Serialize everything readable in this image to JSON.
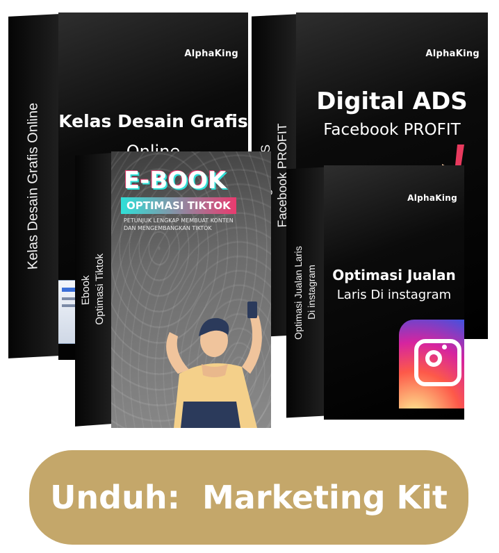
{
  "products": {
    "box1": {
      "spine": "Kelas Desain Grafis Online",
      "brand": "AlphaKing",
      "title_line1": "Kelas Desain Grafis",
      "title_line2": "Online"
    },
    "box2": {
      "spine_line1": "Digital ADS",
      "spine_line2": "Facebook PROFIT",
      "brand": "AlphaKing",
      "title": "Digital ADS",
      "subtitle": "Facebook PROFIT"
    },
    "box3": {
      "spine_line1": "Ebook",
      "spine_line2": "Optimasi Tiktok",
      "title": "E-BOOK",
      "ribbon": "OPTIMASI TIKTOK",
      "tagline_line1": "PETUNJUK LENGKAP MEMBUAT KONTEN",
      "tagline_line2": "DAN MENGEMBANGKAN TIKTOK"
    },
    "box4": {
      "spine_line1": "Optimasi Jualan Laris",
      "spine_line2": "Di instagram",
      "brand": "AlphaKing",
      "title": "Optimasi Jualan",
      "subtitle": "Laris Di instagram"
    }
  },
  "cta": {
    "label": "Unduh:  Marketing Kit"
  },
  "colors": {
    "cta_bg": "#c4a76a",
    "box_black": "#000000",
    "ebook_accent": "#2fe0d8",
    "ebook_ribbon": "#e93a6e"
  }
}
